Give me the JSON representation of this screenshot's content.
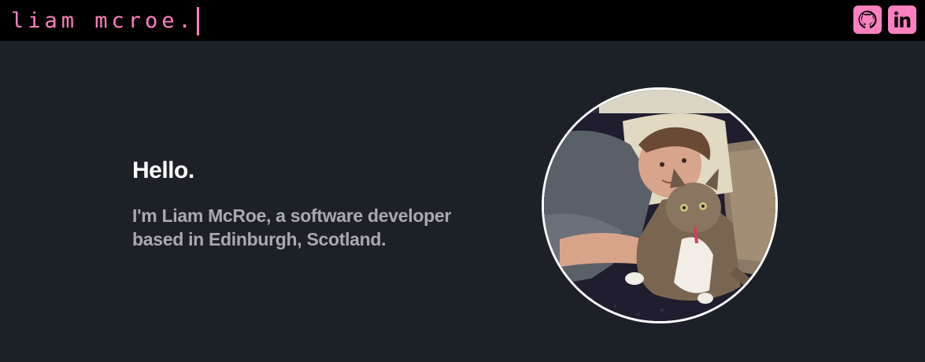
{
  "header": {
    "logo_text": "liam mcroe.",
    "accent_color": "#ff80c0",
    "links": [
      {
        "name": "github",
        "icon": "github-icon"
      },
      {
        "name": "linkedin",
        "icon": "linkedin-icon"
      }
    ]
  },
  "hero": {
    "title": "Hello.",
    "subtitle_line1": "I'm Liam McRoe, a software developer",
    "subtitle_line2": "based in Edinburgh, Scotland."
  },
  "avatar": {
    "description_icon": "profile-photo"
  },
  "colors": {
    "background": "#1c2127",
    "topbar": "#000000",
    "title": "#ffffff",
    "subtitle": "#a9aaac"
  }
}
